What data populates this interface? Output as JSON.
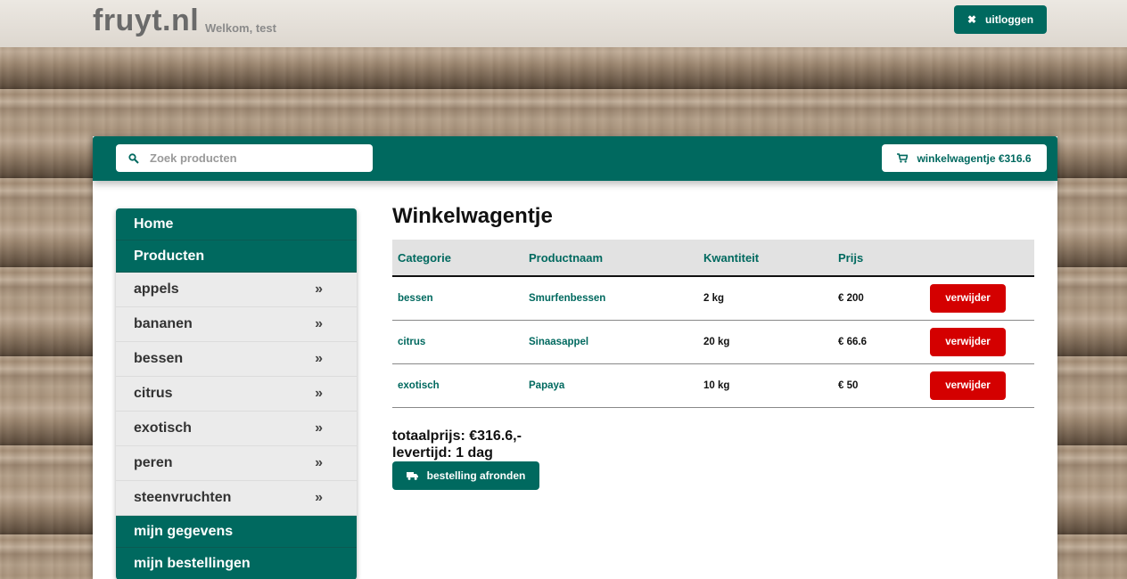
{
  "header": {
    "logo": "fruyt.nl",
    "welcome": "Welkom, test",
    "logout_label": "uitloggen"
  },
  "toolbar": {
    "search_placeholder": "Zoek producten",
    "cart_label": "winkelwagentje €316.6"
  },
  "sidebar": {
    "home": "Home",
    "products": "Producten",
    "categories": [
      "appels",
      "bananen",
      "bessen",
      "citrus",
      "exotisch",
      "peren",
      "steenvruchten"
    ],
    "my_details": "mijn gegevens",
    "my_orders": "mijn bestellingen"
  },
  "cart": {
    "title": "Winkelwagentje",
    "columns": [
      "Categorie",
      "Productnaam",
      "Kwantiteit",
      "Prijs"
    ],
    "rows": [
      {
        "category": "bessen",
        "product": "Smurfenbessen",
        "quantity": "2 kg",
        "price": "€ 200",
        "action": "verwijder"
      },
      {
        "category": "citrus",
        "product": "Sinaasappel",
        "quantity": "20 kg",
        "price": "€ 66.6",
        "action": "verwijder"
      },
      {
        "category": "exotisch",
        "product": "Papaya",
        "quantity": "10 kg",
        "price": "€ 50",
        "action": "verwijder"
      }
    ],
    "total": "totaalprijs: €316.6,-",
    "delivery": "levertijd: 1 dag",
    "checkout_label": "bestelling afronden"
  },
  "colors": {
    "brand": "#00695f",
    "danger": "#d40000"
  }
}
